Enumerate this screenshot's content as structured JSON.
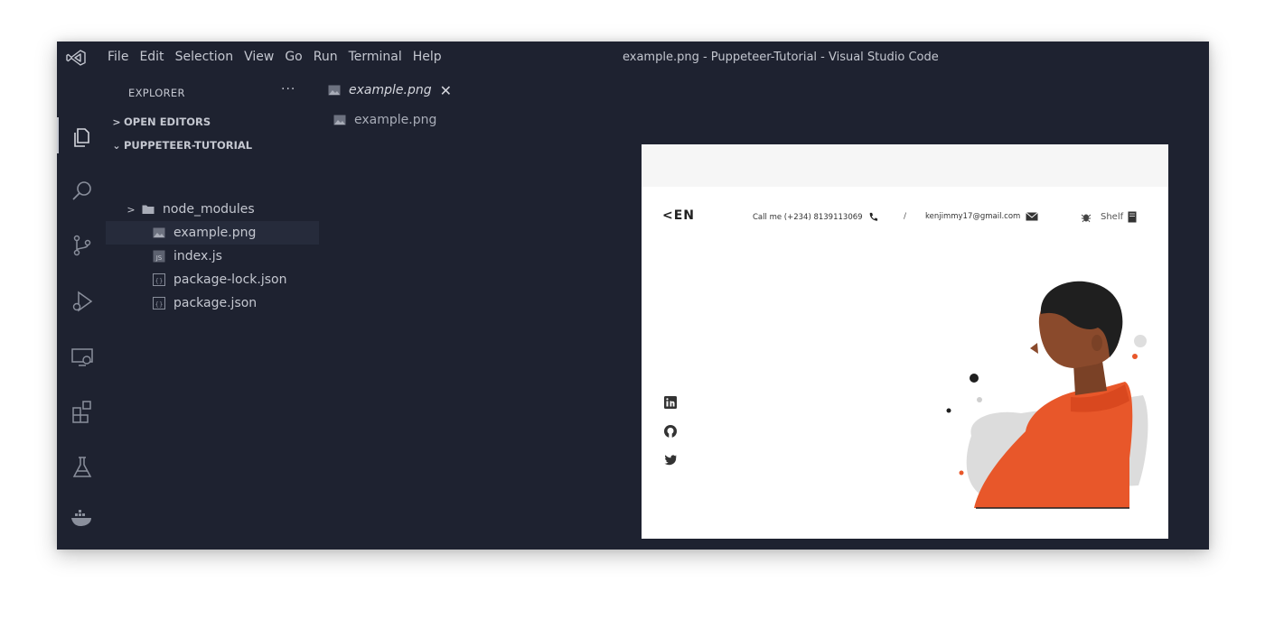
{
  "titlebar": {
    "menu": [
      "File",
      "Edit",
      "Selection",
      "View",
      "Go",
      "Run",
      "Terminal",
      "Help"
    ],
    "window_title": "example.png - Puppeteer-Tutorial - Visual Studio Code"
  },
  "activity_bar": {
    "icons": [
      "explorer-icon",
      "search-icon",
      "source-control-icon",
      "run-debug-icon",
      "remote-explorer-icon",
      "extensions-icon",
      "testing-icon",
      "docker-icon"
    ]
  },
  "sidebar": {
    "title": "EXPLORER",
    "more": "···",
    "open_editors": "OPEN EDITORS",
    "project": "PUPPETEER-TUTORIAL",
    "items": [
      {
        "label": "node_modules",
        "type": "folder"
      },
      {
        "label": "example.png",
        "type": "image",
        "selected": true
      },
      {
        "label": "index.js",
        "type": "js"
      },
      {
        "label": "package-lock.json",
        "type": "json"
      },
      {
        "label": "package.json",
        "type": "json"
      }
    ]
  },
  "editor": {
    "tab_label": "example.png",
    "breadcrumb": "example.png"
  },
  "preview": {
    "logo": "<EN",
    "call": "Call me (+234) 8139113069",
    "separator": "/",
    "email": "kenjimmy17@gmail.com",
    "shelf": "Shelf",
    "social": [
      "linkedin-icon",
      "github-icon",
      "twitter-icon"
    ],
    "colors": {
      "accent": "#e8572a",
      "dark": "#1f1f1f"
    }
  },
  "colors": {
    "window_bg": "#1e2230",
    "selected_row": "#262b3b",
    "text": "#c4c7d0"
  }
}
